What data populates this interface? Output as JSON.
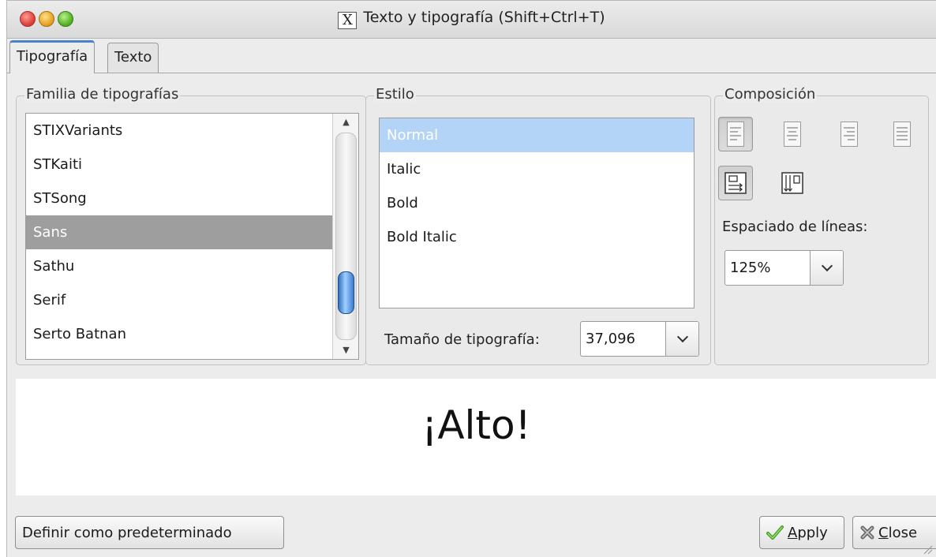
{
  "window": {
    "title": "Texto y tipografía (Shift+Ctrl+T)",
    "icon": "x-app-icon"
  },
  "tabs": [
    {
      "label": "Tipografía",
      "active": true
    },
    {
      "label": "Texto",
      "active": false
    }
  ],
  "family": {
    "legend": "Familia de tipografías",
    "items": [
      "STIXVariants",
      "STKaiti",
      "STSong",
      "Sans",
      "Sathu",
      "Serif",
      "Serto Batnan"
    ],
    "selected": "Sans"
  },
  "style": {
    "legend": "Estilo",
    "items": [
      "Normal",
      "Italic",
      "Bold",
      "Bold Italic"
    ],
    "selected": "Normal",
    "size_label": "Tamaño de tipografía:",
    "size_value": "37,096"
  },
  "composition": {
    "legend": "Composición",
    "alignments": [
      "align-left-icon",
      "align-center-icon",
      "align-right-icon",
      "align-justify-icon"
    ],
    "selected_alignment": "align-left-icon",
    "directions": [
      "horizontal-text-icon",
      "vertical-text-icon"
    ],
    "selected_direction": "horizontal-text-icon",
    "line_spacing_label": "Espaciado de líneas:",
    "line_spacing_value": "125%"
  },
  "preview": {
    "text": "¡Alto!"
  },
  "buttons": {
    "set_default": "Definir como predeterminado",
    "apply_prefix": "",
    "apply_mnemonic": "A",
    "apply_rest": "pply",
    "close_mnemonic": "C",
    "close_rest": "lose"
  },
  "colors": {
    "selection_gray": "#9e9e9e",
    "selection_blue": "#b3d4f7",
    "tab_accent": "#4a84c8"
  }
}
